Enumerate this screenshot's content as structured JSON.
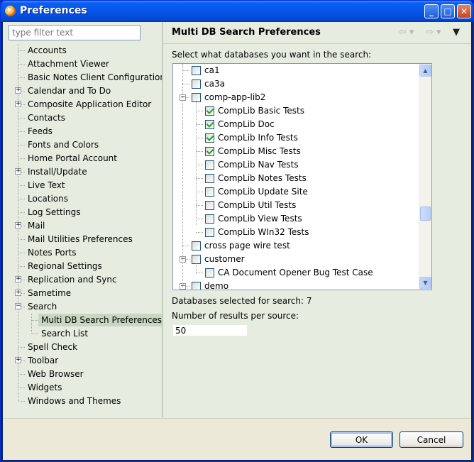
{
  "window": {
    "title": "Preferences"
  },
  "filter": {
    "placeholder": "type filter text"
  },
  "tree": [
    {
      "label": "Accounts",
      "level": 0,
      "expandable": false
    },
    {
      "label": "Attachment Viewer",
      "level": 0,
      "expandable": false
    },
    {
      "label": "Basic Notes Client Configuration",
      "level": 0,
      "expandable": false
    },
    {
      "label": "Calendar and To Do",
      "level": 0,
      "expandable": true,
      "expanded": false
    },
    {
      "label": "Composite Application Editor",
      "level": 0,
      "expandable": true,
      "expanded": false
    },
    {
      "label": "Contacts",
      "level": 0,
      "expandable": false
    },
    {
      "label": "Feeds",
      "level": 0,
      "expandable": false
    },
    {
      "label": "Fonts and Colors",
      "level": 0,
      "expandable": false
    },
    {
      "label": "Home Portal Account",
      "level": 0,
      "expandable": false
    },
    {
      "label": "Install/Update",
      "level": 0,
      "expandable": true,
      "expanded": false
    },
    {
      "label": "Live Text",
      "level": 0,
      "expandable": false
    },
    {
      "label": "Locations",
      "level": 0,
      "expandable": false
    },
    {
      "label": "Log Settings",
      "level": 0,
      "expandable": false
    },
    {
      "label": "Mail",
      "level": 0,
      "expandable": true,
      "expanded": false
    },
    {
      "label": "Mail Utilities Preferences",
      "level": 0,
      "expandable": false
    },
    {
      "label": "Notes Ports",
      "level": 0,
      "expandable": false
    },
    {
      "label": "Regional Settings",
      "level": 0,
      "expandable": false
    },
    {
      "label": "Replication and Sync",
      "level": 0,
      "expandable": true,
      "expanded": false
    },
    {
      "label": "Sametime",
      "level": 0,
      "expandable": true,
      "expanded": false
    },
    {
      "label": "Search",
      "level": 0,
      "expandable": true,
      "expanded": true
    },
    {
      "label": "Multi DB Search Preferences",
      "level": 1,
      "expandable": false,
      "selected": true
    },
    {
      "label": "Search List",
      "level": 1,
      "expandable": false
    },
    {
      "label": "Spell Check",
      "level": 0,
      "expandable": false
    },
    {
      "label": "Toolbar",
      "level": 0,
      "expandable": true,
      "expanded": false
    },
    {
      "label": "Web Browser",
      "level": 0,
      "expandable": false
    },
    {
      "label": "Widgets",
      "level": 0,
      "expandable": false
    },
    {
      "label": "Windows and Themes",
      "level": 0,
      "expandable": false
    }
  ],
  "page": {
    "title": "Multi DB Search Preferences",
    "instruction": "Select what databases you want in the search:",
    "status": "Databases selected for search: 7",
    "results_label": "Number of results per source:",
    "results_value": "50"
  },
  "databases": [
    {
      "label": "ca1",
      "level": 0,
      "checked": false,
      "expandable": false
    },
    {
      "label": "ca3a",
      "level": 0,
      "checked": false,
      "expandable": false
    },
    {
      "label": "comp-app-lib2",
      "level": 0,
      "checked": false,
      "expandable": true
    },
    {
      "label": "CompLib Basic Tests",
      "level": 1,
      "checked": true,
      "expandable": false
    },
    {
      "label": "CompLib Doc",
      "level": 1,
      "checked": true,
      "expandable": false
    },
    {
      "label": "CompLib Info Tests",
      "level": 1,
      "checked": true,
      "expandable": false
    },
    {
      "label": "CompLib Misc Tests",
      "level": 1,
      "checked": true,
      "expandable": false
    },
    {
      "label": "CompLib Nav Tests",
      "level": 1,
      "checked": false,
      "expandable": false
    },
    {
      "label": "CompLib Notes Tests",
      "level": 1,
      "checked": false,
      "expandable": false
    },
    {
      "label": "CompLib Update Site",
      "level": 1,
      "checked": false,
      "expandable": false
    },
    {
      "label": "CompLib Util Tests",
      "level": 1,
      "checked": false,
      "expandable": false
    },
    {
      "label": "CompLib View Tests",
      "level": 1,
      "checked": false,
      "expandable": false
    },
    {
      "label": "CompLib WIn32 Tests",
      "level": 1,
      "checked": false,
      "expandable": false
    },
    {
      "label": "cross page wire test",
      "level": 0,
      "checked": false,
      "expandable": false
    },
    {
      "label": "customer",
      "level": 0,
      "checked": false,
      "expandable": true
    },
    {
      "label": "CA Document Opener Bug Test Case",
      "level": 1,
      "checked": false,
      "expandable": false
    },
    {
      "label": "demo",
      "level": 0,
      "checked": false,
      "expandable": true
    }
  ],
  "buttons": {
    "ok": "OK",
    "cancel": "Cancel"
  }
}
